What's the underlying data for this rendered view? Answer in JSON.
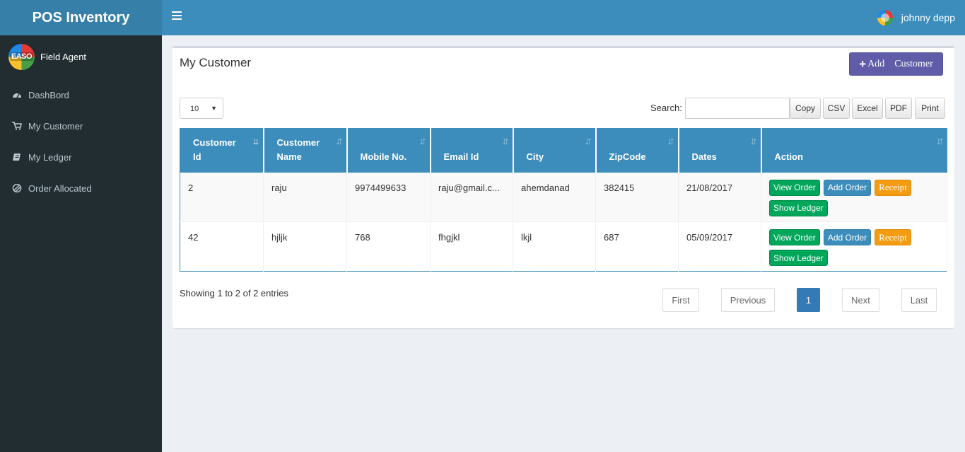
{
  "app": {
    "title": "POS Inventory"
  },
  "topbar": {
    "user_name": "johnny depp"
  },
  "sidebar": {
    "user_role": "Field Agent",
    "avatar_text": "EASO",
    "items": [
      {
        "label": "DashBord",
        "icon": "dashboard-icon"
      },
      {
        "label": "My Customer",
        "icon": "cart-icon"
      },
      {
        "label": "My Ledger",
        "icon": "book-icon"
      },
      {
        "label": "Order Allocated",
        "icon": "pie-icon"
      }
    ]
  },
  "box": {
    "title": "My Customer",
    "add_button": "Add    Customer",
    "page_length": "10",
    "search_label": "Search:",
    "search_value": "",
    "export_buttons": [
      "Copy",
      "CSV",
      "Excel",
      "PDF",
      "Print"
    ]
  },
  "table": {
    "headers": [
      {
        "line1": "Customer",
        "line2": "Id"
      },
      {
        "line1": "Customer",
        "line2": "Name"
      },
      {
        "line1": "",
        "line2": "Mobile No."
      },
      {
        "line1": "",
        "line2": "Email Id"
      },
      {
        "line1": "",
        "line2": "City"
      },
      {
        "line1": "",
        "line2": "ZipCode"
      },
      {
        "line1": "",
        "line2": "Dates"
      },
      {
        "line1": "",
        "line2": "Action"
      }
    ],
    "rows": [
      {
        "id": "2",
        "name": "raju",
        "mobile": "9974499633",
        "email": "raju@gmail.c...",
        "city": "ahemdanad",
        "zip": "382415",
        "date": "21/08/2017"
      },
      {
        "id": "42",
        "name": "hjljk",
        "mobile": "768",
        "email": "fhgjkl",
        "city": "lkjl",
        "zip": "687",
        "date": "05/09/2017"
      }
    ],
    "action_labels": {
      "view": "View Order",
      "add": "Add Order",
      "receipt": "Receipt",
      "ledger": "Show Ledger"
    }
  },
  "footer": {
    "info": "Showing 1 to 2 of 2 entries",
    "pagination": {
      "first": "First",
      "previous": "Previous",
      "current": "1",
      "next": "Next",
      "last": "Last"
    }
  },
  "colors": {
    "header_blue": "#3c8dbc",
    "logo_blue": "#367fa9",
    "sidebar_bg": "#222d32",
    "add_button": "#605ca8",
    "green": "#00a65a",
    "orange": "#f39c12"
  }
}
